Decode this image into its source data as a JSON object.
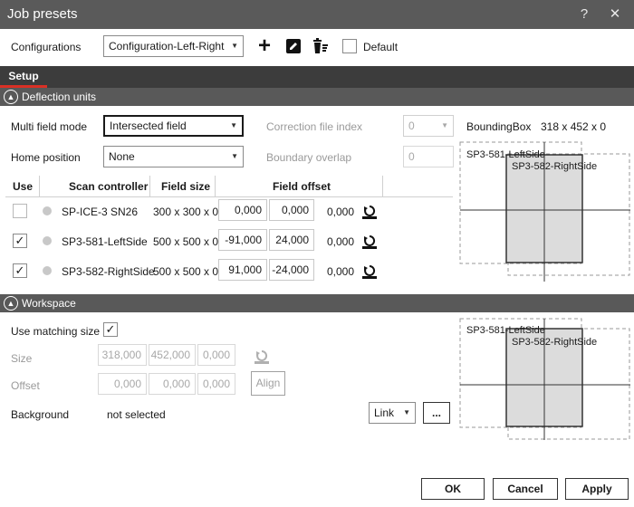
{
  "window": {
    "title": "Job presets",
    "help_glyph": "?",
    "close_glyph": "✕"
  },
  "toolbar": {
    "configurations_label": "Configurations",
    "configuration_value": "Configuration-Left-Right",
    "default_label": "Default",
    "add_glyph": "+",
    "default_checked": false
  },
  "tabs": [
    {
      "label": "Setup",
      "active": true
    }
  ],
  "deflection": {
    "section_title": "Deflection units",
    "multi_field_mode_label": "Multi field mode",
    "multi_field_mode_value": "Intersected field",
    "home_position_label": "Home position",
    "home_position_value": "None",
    "correction_file_index_label": "Correction file index",
    "correction_file_index_value": "0",
    "boundary_overlap_label": "Boundary overlap",
    "boundary_overlap_value": "0",
    "bounding_box_label": "BoundingBox",
    "bounding_box_value": "318 x 452 x 0",
    "columns": {
      "use": "Use",
      "scan_controller": "Scan controller",
      "field_size": "Field size",
      "field_offset": "Field offset"
    },
    "rows": [
      {
        "use": false,
        "controller": "SP-ICE-3 SN26",
        "field_size": "300 x 300 x 0",
        "offset_x": "0,000",
        "offset_y": "0,000",
        "offset_z": "0,000"
      },
      {
        "use": true,
        "controller": "SP3-581-LeftSide",
        "field_size": "500 x 500 x 0",
        "offset_x": "-91,000",
        "offset_y": "24,000",
        "offset_z": "0,000"
      },
      {
        "use": true,
        "controller": "SP3-582-RightSide",
        "field_size": "500 x 500 x 0",
        "offset_x": "91,000",
        "offset_y": "-24,000",
        "offset_z": "0,000"
      }
    ],
    "preview": {
      "left_label": "SP3-581-LeftSide",
      "right_label": "SP3-582-RightSide"
    }
  },
  "workspace": {
    "section_title": "Workspace",
    "use_matching_size_label": "Use matching size",
    "use_matching_size_checked": true,
    "size_label": "Size",
    "size_x": "318,000",
    "size_y": "452,000",
    "size_z": "0,000",
    "offset_label": "Offset",
    "offset_x": "0,000",
    "offset_y": "0,000",
    "offset_z": "0,000",
    "align_label": "Align",
    "background_label": "Background",
    "background_value": "not selected",
    "link_value": "Link",
    "browse_label": "...",
    "preview": {
      "left_label": "SP3-581-LeftSide",
      "right_label": "SP3-582-RightSide"
    }
  },
  "footer": {
    "ok_label": "OK",
    "cancel_label": "Cancel",
    "apply_label": "Apply"
  },
  "colors": {
    "title_bar": "#5a5a5a",
    "tab_strip": "#3c3c3c",
    "section_header": "#595959",
    "tab_underline": "#d93025",
    "field_fill": "#dcdcdc"
  }
}
